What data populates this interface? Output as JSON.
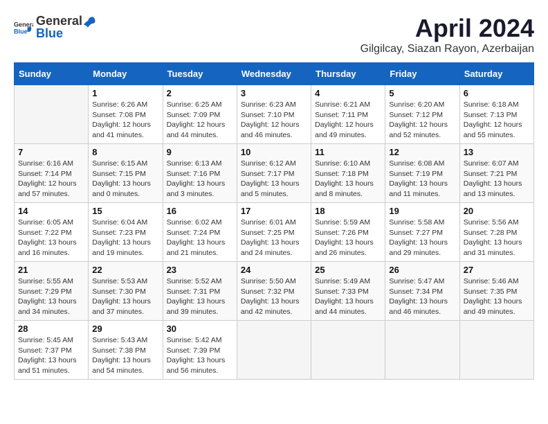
{
  "header": {
    "logo_general": "General",
    "logo_blue": "Blue",
    "month_year": "April 2024",
    "location": "Gilgilcay, Siazan Rayon, Azerbaijan"
  },
  "weekdays": [
    "Sunday",
    "Monday",
    "Tuesday",
    "Wednesday",
    "Thursday",
    "Friday",
    "Saturday"
  ],
  "weeks": [
    [
      {
        "day": "",
        "sunrise": "",
        "sunset": "",
        "daylight": ""
      },
      {
        "day": "1",
        "sunrise": "Sunrise: 6:26 AM",
        "sunset": "Sunset: 7:08 PM",
        "daylight": "Daylight: 12 hours and 41 minutes."
      },
      {
        "day": "2",
        "sunrise": "Sunrise: 6:25 AM",
        "sunset": "Sunset: 7:09 PM",
        "daylight": "Daylight: 12 hours and 44 minutes."
      },
      {
        "day": "3",
        "sunrise": "Sunrise: 6:23 AM",
        "sunset": "Sunset: 7:10 PM",
        "daylight": "Daylight: 12 hours and 46 minutes."
      },
      {
        "day": "4",
        "sunrise": "Sunrise: 6:21 AM",
        "sunset": "Sunset: 7:11 PM",
        "daylight": "Daylight: 12 hours and 49 minutes."
      },
      {
        "day": "5",
        "sunrise": "Sunrise: 6:20 AM",
        "sunset": "Sunset: 7:12 PM",
        "daylight": "Daylight: 12 hours and 52 minutes."
      },
      {
        "day": "6",
        "sunrise": "Sunrise: 6:18 AM",
        "sunset": "Sunset: 7:13 PM",
        "daylight": "Daylight: 12 hours and 55 minutes."
      }
    ],
    [
      {
        "day": "7",
        "sunrise": "Sunrise: 6:16 AM",
        "sunset": "Sunset: 7:14 PM",
        "daylight": "Daylight: 12 hours and 57 minutes."
      },
      {
        "day": "8",
        "sunrise": "Sunrise: 6:15 AM",
        "sunset": "Sunset: 7:15 PM",
        "daylight": "Daylight: 13 hours and 0 minutes."
      },
      {
        "day": "9",
        "sunrise": "Sunrise: 6:13 AM",
        "sunset": "Sunset: 7:16 PM",
        "daylight": "Daylight: 13 hours and 3 minutes."
      },
      {
        "day": "10",
        "sunrise": "Sunrise: 6:12 AM",
        "sunset": "Sunset: 7:17 PM",
        "daylight": "Daylight: 13 hours and 5 minutes."
      },
      {
        "day": "11",
        "sunrise": "Sunrise: 6:10 AM",
        "sunset": "Sunset: 7:18 PM",
        "daylight": "Daylight: 13 hours and 8 minutes."
      },
      {
        "day": "12",
        "sunrise": "Sunrise: 6:08 AM",
        "sunset": "Sunset: 7:19 PM",
        "daylight": "Daylight: 13 hours and 11 minutes."
      },
      {
        "day": "13",
        "sunrise": "Sunrise: 6:07 AM",
        "sunset": "Sunset: 7:21 PM",
        "daylight": "Daylight: 13 hours and 13 minutes."
      }
    ],
    [
      {
        "day": "14",
        "sunrise": "Sunrise: 6:05 AM",
        "sunset": "Sunset: 7:22 PM",
        "daylight": "Daylight: 13 hours and 16 minutes."
      },
      {
        "day": "15",
        "sunrise": "Sunrise: 6:04 AM",
        "sunset": "Sunset: 7:23 PM",
        "daylight": "Daylight: 13 hours and 19 minutes."
      },
      {
        "day": "16",
        "sunrise": "Sunrise: 6:02 AM",
        "sunset": "Sunset: 7:24 PM",
        "daylight": "Daylight: 13 hours and 21 minutes."
      },
      {
        "day": "17",
        "sunrise": "Sunrise: 6:01 AM",
        "sunset": "Sunset: 7:25 PM",
        "daylight": "Daylight: 13 hours and 24 minutes."
      },
      {
        "day": "18",
        "sunrise": "Sunrise: 5:59 AM",
        "sunset": "Sunset: 7:26 PM",
        "daylight": "Daylight: 13 hours and 26 minutes."
      },
      {
        "day": "19",
        "sunrise": "Sunrise: 5:58 AM",
        "sunset": "Sunset: 7:27 PM",
        "daylight": "Daylight: 13 hours and 29 minutes."
      },
      {
        "day": "20",
        "sunrise": "Sunrise: 5:56 AM",
        "sunset": "Sunset: 7:28 PM",
        "daylight": "Daylight: 13 hours and 31 minutes."
      }
    ],
    [
      {
        "day": "21",
        "sunrise": "Sunrise: 5:55 AM",
        "sunset": "Sunset: 7:29 PM",
        "daylight": "Daylight: 13 hours and 34 minutes."
      },
      {
        "day": "22",
        "sunrise": "Sunrise: 5:53 AM",
        "sunset": "Sunset: 7:30 PM",
        "daylight": "Daylight: 13 hours and 37 minutes."
      },
      {
        "day": "23",
        "sunrise": "Sunrise: 5:52 AM",
        "sunset": "Sunset: 7:31 PM",
        "daylight": "Daylight: 13 hours and 39 minutes."
      },
      {
        "day": "24",
        "sunrise": "Sunrise: 5:50 AM",
        "sunset": "Sunset: 7:32 PM",
        "daylight": "Daylight: 13 hours and 42 minutes."
      },
      {
        "day": "25",
        "sunrise": "Sunrise: 5:49 AM",
        "sunset": "Sunset: 7:33 PM",
        "daylight": "Daylight: 13 hours and 44 minutes."
      },
      {
        "day": "26",
        "sunrise": "Sunrise: 5:47 AM",
        "sunset": "Sunset: 7:34 PM",
        "daylight": "Daylight: 13 hours and 46 minutes."
      },
      {
        "day": "27",
        "sunrise": "Sunrise: 5:46 AM",
        "sunset": "Sunset: 7:35 PM",
        "daylight": "Daylight: 13 hours and 49 minutes."
      }
    ],
    [
      {
        "day": "28",
        "sunrise": "Sunrise: 5:45 AM",
        "sunset": "Sunset: 7:37 PM",
        "daylight": "Daylight: 13 hours and 51 minutes."
      },
      {
        "day": "29",
        "sunrise": "Sunrise: 5:43 AM",
        "sunset": "Sunset: 7:38 PM",
        "daylight": "Daylight: 13 hours and 54 minutes."
      },
      {
        "day": "30",
        "sunrise": "Sunrise: 5:42 AM",
        "sunset": "Sunset: 7:39 PM",
        "daylight": "Daylight: 13 hours and 56 minutes."
      },
      {
        "day": "",
        "sunrise": "",
        "sunset": "",
        "daylight": ""
      },
      {
        "day": "",
        "sunrise": "",
        "sunset": "",
        "daylight": ""
      },
      {
        "day": "",
        "sunrise": "",
        "sunset": "",
        "daylight": ""
      },
      {
        "day": "",
        "sunrise": "",
        "sunset": "",
        "daylight": ""
      }
    ]
  ]
}
